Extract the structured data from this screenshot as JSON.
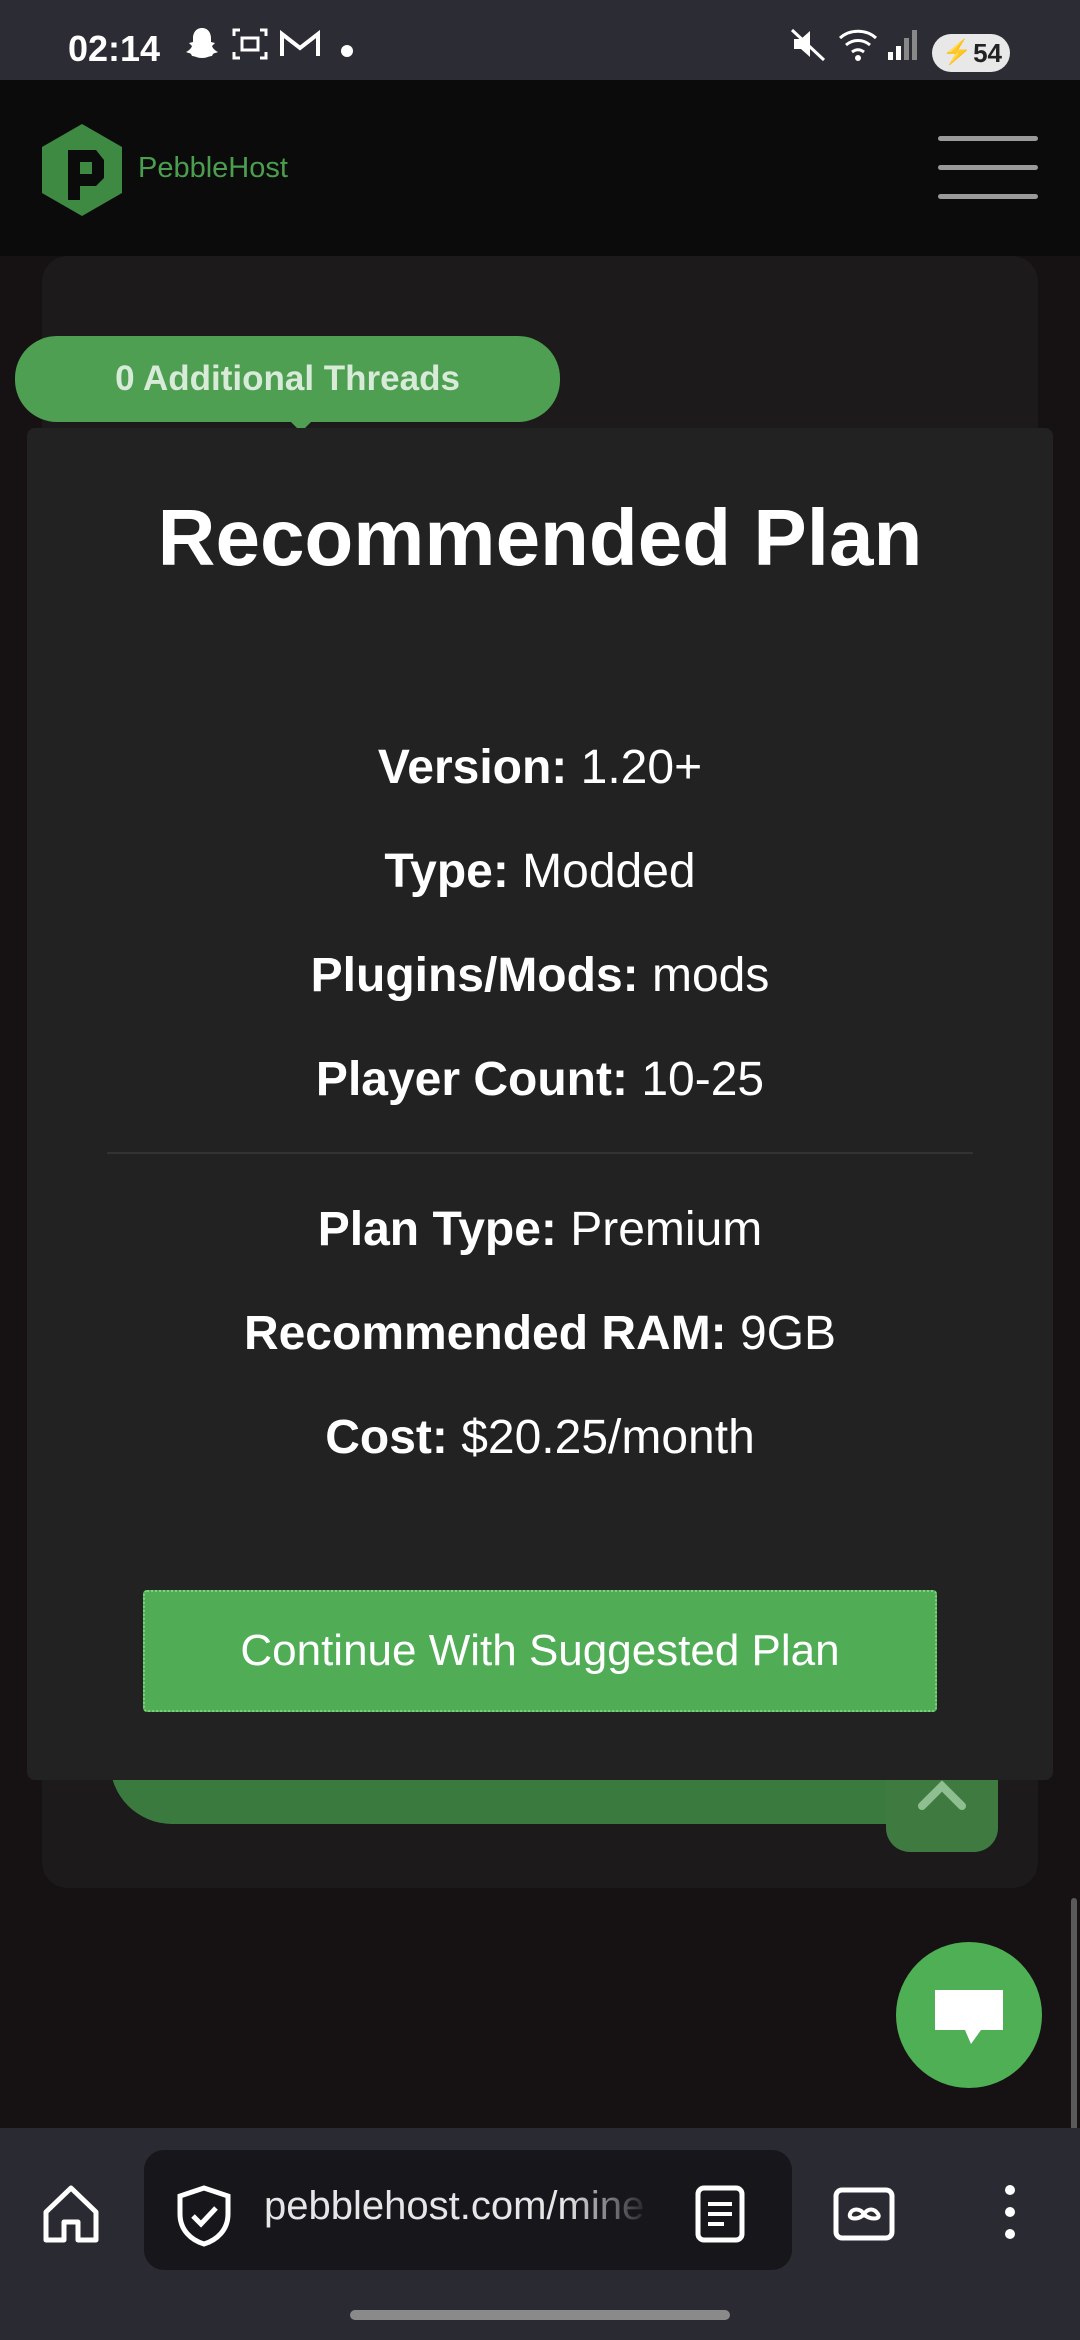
{
  "status_bar": {
    "time": "02:14",
    "battery": "54"
  },
  "header": {
    "brand": "PebbleHost",
    "accent_color": "#4b9e4f"
  },
  "threads_pill": {
    "label": "0 Additional Threads"
  },
  "modal": {
    "title": "Recommended Plan",
    "details": [
      {
        "label": "Version:",
        "value": "1.20+"
      },
      {
        "label": "Type:",
        "value": "Modded"
      },
      {
        "label": "Plugins/Mods:",
        "value": "mods"
      },
      {
        "label": "Player Count:",
        "value": "10-25"
      }
    ],
    "plan": [
      {
        "label": "Plan Type:",
        "value": "Premium"
      },
      {
        "label": "Recommended RAM:",
        "value": "9GB"
      },
      {
        "label": "Cost:",
        "value": "$20.25/month"
      }
    ],
    "cta_label": "Continue With Suggested Plan",
    "cta_color": "#50ad56"
  },
  "browser": {
    "url": "pebblehost.com/mine"
  }
}
